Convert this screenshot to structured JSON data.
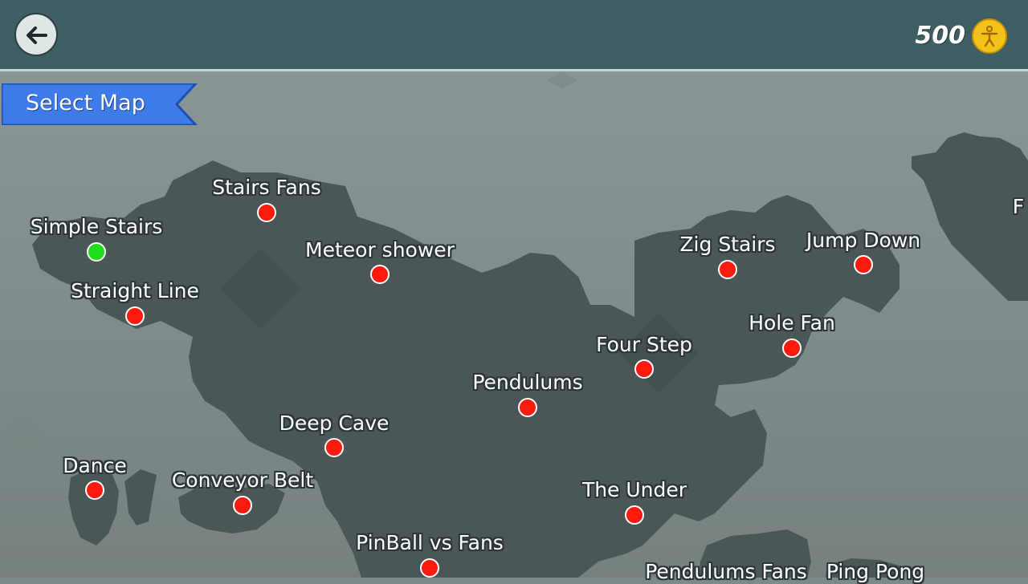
{
  "header": {
    "back_icon": "arrow-left-icon",
    "coins": "500",
    "coin_icon": "person-coin-icon"
  },
  "banner": {
    "label": "Select Map"
  },
  "colors": {
    "topbar": "#3f5e63",
    "land": "#4a5657",
    "banner": "#3d7be8",
    "level_locked": "#ff1a0f",
    "level_unlocked": "#22dd1d"
  },
  "levels": [
    {
      "name": "Stairs Fans",
      "status": "locked"
    },
    {
      "name": "Simple Stairs",
      "status": "unlocked"
    },
    {
      "name": "Meteor shower",
      "status": "locked"
    },
    {
      "name": "Straight Line",
      "status": "locked"
    },
    {
      "name": "Zig Stairs",
      "status": "locked"
    },
    {
      "name": "Jump Down",
      "status": "locked"
    },
    {
      "name": "Hole Fan",
      "status": "locked"
    },
    {
      "name": "Four Step",
      "status": "locked"
    },
    {
      "name": "Pendulums",
      "status": "locked"
    },
    {
      "name": "Deep Cave",
      "status": "locked"
    },
    {
      "name": "Dance",
      "status": "locked"
    },
    {
      "name": "Conveyor Belt",
      "status": "locked"
    },
    {
      "name": "The Under",
      "status": "locked"
    },
    {
      "name": "PinBall vs Fans",
      "status": "locked"
    },
    {
      "name": "Pendulums Fans",
      "status": "locked"
    },
    {
      "name": "Ping Pong",
      "status": "locked"
    },
    {
      "name": "F",
      "status": "locked"
    }
  ]
}
